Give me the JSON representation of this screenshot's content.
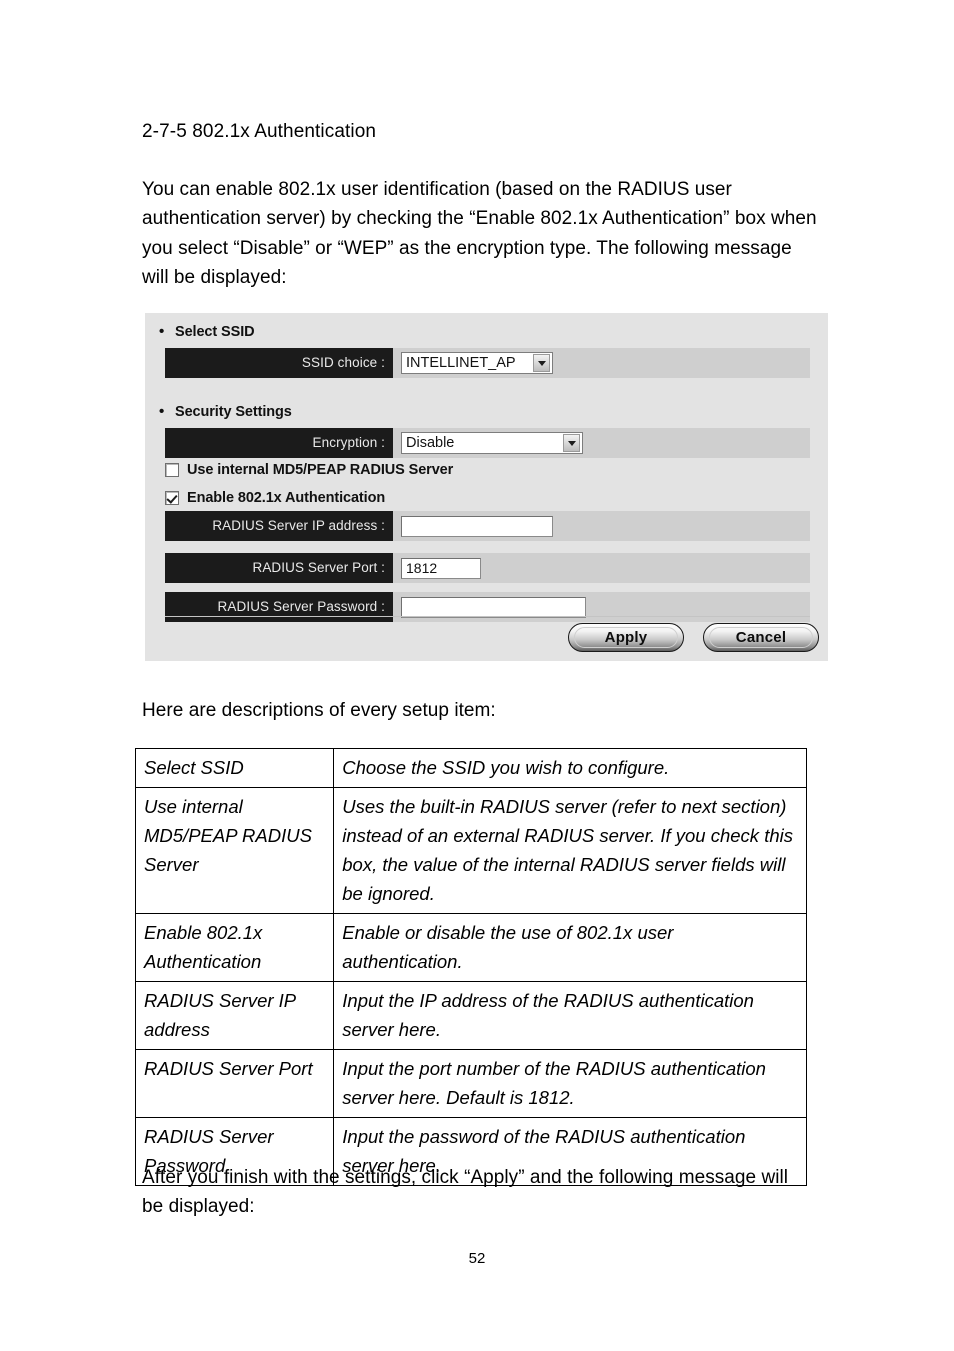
{
  "document": {
    "heading": "2-7-5 802.1x Authentication",
    "intro_paragraph": "You can enable 802.1x user identification (based on the RADIUS user authentication server) by checking the “Enable 802.1x Authentication” box when you select “Disable” or “WEP” as the encryption type. The following message will be displayed:",
    "descriptions_lead": "Here are descriptions of every setup item:",
    "closing_paragraph": "After you finish with the settings, click “Apply” and the following message will be displayed:",
    "page_number": "52"
  },
  "figure": {
    "sections": {
      "select_ssid": "Select SSID",
      "security_settings": "Security Settings"
    },
    "fields": {
      "ssid_choice": {
        "label": "SSID choice :",
        "value": "INTELLINET_AP",
        "type": "select"
      },
      "encryption": {
        "label": "Encryption :",
        "value": "Disable",
        "type": "select"
      },
      "radius_ip": {
        "label": "RADIUS Server IP address :",
        "value": "",
        "type": "text"
      },
      "radius_port": {
        "label": "RADIUS Server Port :",
        "value": "1812",
        "type": "text"
      },
      "radius_password": {
        "label": "RADIUS Server Password :",
        "value": "",
        "type": "text"
      }
    },
    "checkboxes": {
      "use_internal_radius": {
        "label": "Use internal MD5/PEAP RADIUS Server",
        "checked": false
      },
      "enable_8021x": {
        "label": "Enable 802.1x Authentication",
        "checked": true
      }
    },
    "buttons": {
      "apply": "Apply",
      "cancel": "Cancel"
    },
    "colors": {
      "panel_background": "#e3e3e3",
      "row_background": "#cfcfcf",
      "label_background": "#1b1b1b",
      "label_text": "#e9e9e9"
    }
  },
  "description_table": {
    "rows": [
      {
        "term": "Select SSID",
        "definition": "Choose the SSID you wish to configure."
      },
      {
        "term": "Use internal MD5/PEAP RADIUS Server",
        "definition": "Uses the built-in RADIUS server (refer to next section) instead of an external RADIUS server. If you check this box, the value of the internal RADIUS server fields will be ignored."
      },
      {
        "term": "Enable 802.1x Authentication",
        "definition": "Enable or disable the use of 802.1x user authentication."
      },
      {
        "term": "RADIUS Server IP address",
        "definition": "Input the IP address of the RADIUS authentication server here."
      },
      {
        "term": "RADIUS Server Port",
        "definition": "Input the port number of the RADIUS authentication server here. Default is 1812."
      },
      {
        "term": "RADIUS Server Password",
        "definition": "Input the password of the RADIUS authentication server here."
      }
    ]
  }
}
